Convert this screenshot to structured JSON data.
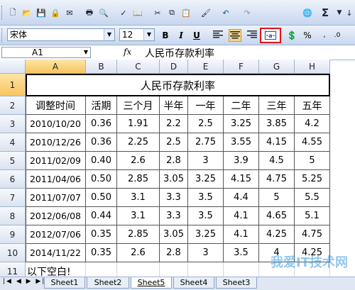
{
  "toolbar": {
    "font_name": "宋体",
    "font_size": "12",
    "bold": "B",
    "italic": "I",
    "underline": "U",
    "sigma": "Σ",
    "percent": "%"
  },
  "formula_bar": {
    "name_box": "A1",
    "fx": "fx",
    "content": "人民币存款利率"
  },
  "columns": [
    "A",
    "B",
    "C",
    "D",
    "E",
    "F",
    "G",
    "H"
  ],
  "rows": [
    "1",
    "2",
    "3",
    "4",
    "5",
    "6",
    "7",
    "8",
    "9",
    "10",
    "11"
  ],
  "title": "人民币存款利率",
  "headers": [
    "调整时间",
    "活期",
    "三个月",
    "半年",
    "一年",
    "二年",
    "三年",
    "五年"
  ],
  "data": [
    [
      "2010/10/20",
      "0.36",
      "1.91",
      "2.2",
      "2.5",
      "3.25",
      "3.85",
      "4.2"
    ],
    [
      "2010/12/26",
      "0.36",
      "2.25",
      "2.5",
      "2.75",
      "3.55",
      "4.15",
      "4.55"
    ],
    [
      "2011/02/09",
      "0.40",
      "2.6",
      "2.8",
      "3",
      "3.9",
      "4.5",
      "5"
    ],
    [
      "2011/04/06",
      "0.50",
      "2.85",
      "3.05",
      "3.25",
      "4.15",
      "4.75",
      "5.25"
    ],
    [
      "2011/07/07",
      "0.50",
      "3.1",
      "3.3",
      "3.5",
      "4.4",
      "5",
      "5.5"
    ],
    [
      "2012/06/08",
      "0.44",
      "3.1",
      "3.3",
      "3.5",
      "4.1",
      "4.65",
      "5.1"
    ],
    [
      "2012/07/06",
      "0.35",
      "2.85",
      "3.05",
      "3.25",
      "4.1",
      "4.25",
      "4.75"
    ],
    [
      "2014/11/22",
      "0.35",
      "2.6",
      "2.8",
      "3",
      "3.5",
      "4",
      "4.25"
    ]
  ],
  "note": "以下空白!",
  "sheet_tabs": [
    "Sheet1",
    "Sheet2",
    "Sheet5",
    "Sheet4",
    "Sheet3"
  ],
  "watermark": "我爱IT技术网",
  "colors": {
    "accent_red": "#e0141b",
    "header_bg": "#dbe3f1",
    "selected_header": "#f7c45f"
  }
}
